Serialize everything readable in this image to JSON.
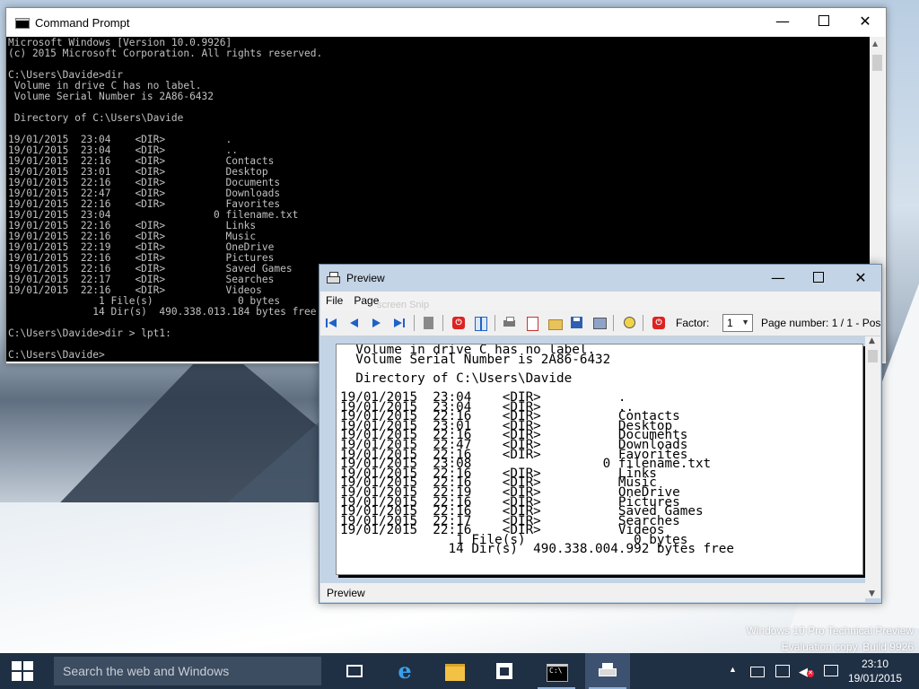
{
  "desktop": {
    "watermark_line1": "Windows 10 Pro Technical Preview",
    "watermark_line2": "Evaluation copy. Build 9926"
  },
  "cmd": {
    "title": "Command Prompt",
    "lines": [
      "Microsoft Windows [Version 10.0.9926]",
      "(c) 2015 Microsoft Corporation. All rights reserved.",
      "",
      "C:\\Users\\Davide>dir",
      " Volume in drive C has no label.",
      " Volume Serial Number is 2A86-6432",
      "",
      " Directory of C:\\Users\\Davide",
      "",
      "19/01/2015  23:04    <DIR>          .",
      "19/01/2015  23:04    <DIR>          ..",
      "19/01/2015  22:16    <DIR>          Contacts",
      "19/01/2015  23:01    <DIR>          Desktop",
      "19/01/2015  22:16    <DIR>          Documents",
      "19/01/2015  22:47    <DIR>          Downloads",
      "19/01/2015  22:16    <DIR>          Favorites",
      "19/01/2015  23:04                 0 filename.txt",
      "19/01/2015  22:16    <DIR>          Links",
      "19/01/2015  22:16    <DIR>          Music",
      "19/01/2015  22:19    <DIR>          OneDrive",
      "19/01/2015  22:16    <DIR>          Pictures",
      "19/01/2015  22:16    <DIR>          Saved Games",
      "19/01/2015  22:17    <DIR>          Searches",
      "19/01/2015  22:16    <DIR>          Videos",
      "               1 File(s)              0 bytes",
      "              14 Dir(s)  490.338.013.184 bytes free",
      "",
      "C:\\Users\\Davide>dir > lpt1:",
      "",
      "C:\\Users\\Davide>"
    ]
  },
  "preview": {
    "title": "Preview",
    "menu": [
      "File",
      "Page"
    ],
    "ghost_text": "screen Snip",
    "factor_label": "Factor:",
    "factor_value": "1",
    "page_number": "Page number: 1 / 1 - Pos",
    "status": "Preview",
    "lines": [
      "  Volume in drive C has no label.",
      "  Volume Serial Number is 2A86-6432",
      "",
      "  Directory of C:\\Users\\Davide",
      "",
      "19/01/2015  23:04    <DIR>          .",
      "19/01/2015  23:04    <DIR>          ..",
      "19/01/2015  22:16    <DIR>          Contacts",
      "19/01/2015  23:01    <DIR>          Desktop",
      "19/01/2015  22:16    <DIR>          Documents",
      "19/01/2015  22:47    <DIR>          Downloads",
      "19/01/2015  22:16    <DIR>          Favorites",
      "19/01/2015  23:08                 0 filename.txt",
      "19/01/2015  22:16    <DIR>          Links",
      "19/01/2015  22:16    <DIR>          Music",
      "19/01/2015  22:19    <DIR>          OneDrive",
      "19/01/2015  22:16    <DIR>          Pictures",
      "19/01/2015  22:16    <DIR>          Saved Games",
      "19/01/2015  22:17    <DIR>          Searches",
      "19/01/2015  22:16    <DIR>          Videos",
      "               1 File(s)              0 bytes",
      "              14 Dir(s)  490.338.004.992 bytes free"
    ]
  },
  "taskbar": {
    "search_placeholder": "Search the web and Windows",
    "time": "23:10",
    "date": "19/01/2015",
    "apps": [
      "task-view",
      "internet-explorer",
      "file-explorer",
      "store",
      "command-prompt",
      "preview"
    ]
  },
  "colors": {
    "taskbar": "#1f2f44",
    "preview_frame": "#c3d4e6",
    "accent": "#1e62c8"
  }
}
